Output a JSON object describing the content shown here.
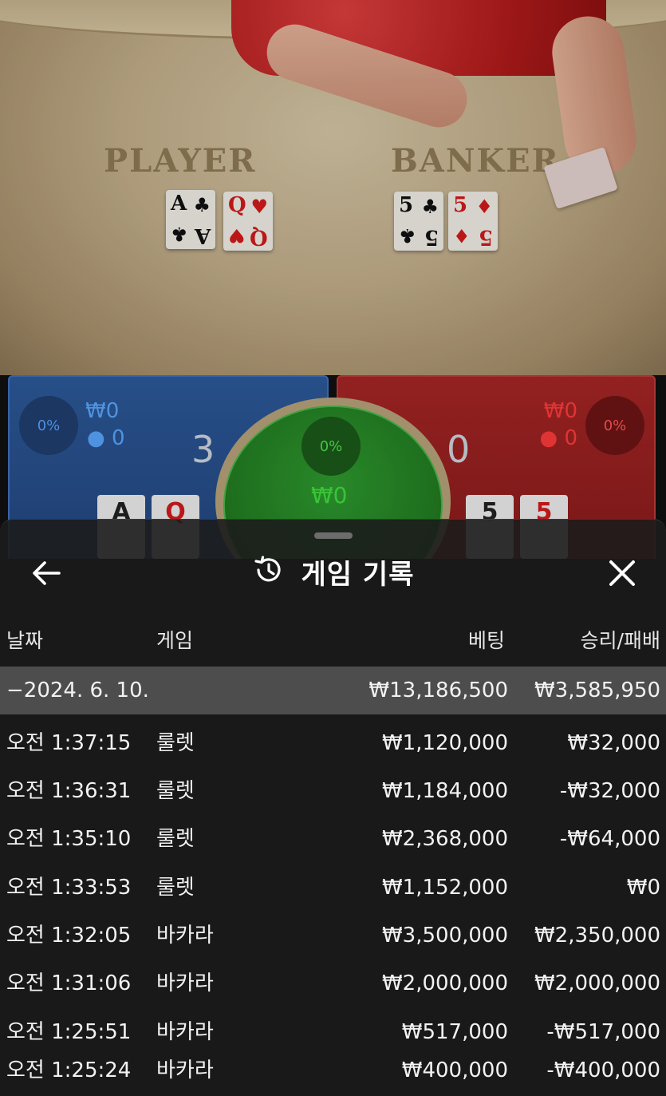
{
  "table": {
    "felt_player_label": "PLAYER",
    "felt_banker_label": "BANKER",
    "player_cards": [
      {
        "rank": "A",
        "suit": "♣",
        "color": "#111111"
      },
      {
        "rank": "Q",
        "suit": "♥",
        "color": "#d41c1c"
      }
    ],
    "banker_cards": [
      {
        "rank": "5",
        "suit": "♣",
        "color": "#111111"
      },
      {
        "rank": "5",
        "suit": "♦",
        "color": "#d41c1c"
      }
    ]
  },
  "betting": {
    "player": {
      "percent": "0%",
      "amount": "₩0",
      "count": "0",
      "score": "3",
      "color": "#3f72c0"
    },
    "tie": {
      "percent": "0%",
      "amount": "₩0"
    },
    "banker": {
      "percent": "0%",
      "amount": "₩0",
      "count": "0",
      "score": "0",
      "color": "#c03c3c"
    }
  },
  "history": {
    "title": "게임 기록",
    "columns": {
      "date": "날짜",
      "game": "게임",
      "bet": "베팅",
      "result": "승리/패배"
    },
    "group": {
      "date": "−2024. 6. 10.",
      "bet": "₩13,186,500",
      "result": "₩3,585,950"
    },
    "rows": [
      {
        "time": "오전 1:37:15",
        "game": "룰렛",
        "bet": "₩1,120,000",
        "result": "₩32,000"
      },
      {
        "time": "오전 1:36:31",
        "game": "룰렛",
        "bet": "₩1,184,000",
        "result": "-₩32,000"
      },
      {
        "time": "오전 1:35:10",
        "game": "룰렛",
        "bet": "₩2,368,000",
        "result": "-₩64,000"
      },
      {
        "time": "오전 1:33:53",
        "game": "룰렛",
        "bet": "₩1,152,000",
        "result": "₩0"
      },
      {
        "time": "오전 1:32:05",
        "game": "바카라",
        "bet": "₩3,500,000",
        "result": "₩2,350,000"
      },
      {
        "time": "오전 1:31:06",
        "game": "바카라",
        "bet": "₩2,000,000",
        "result": "₩2,000,000"
      },
      {
        "time": "오전 1:25:51",
        "game": "바카라",
        "bet": "₩517,000",
        "result": "-₩517,000"
      },
      {
        "time": "오전 1:25:24",
        "game": "바카라",
        "bet": "₩400,000",
        "result": "-₩400,000"
      }
    ]
  },
  "icons": {
    "back": "arrow-left-icon",
    "history": "history-clock-icon",
    "close": "close-icon"
  }
}
